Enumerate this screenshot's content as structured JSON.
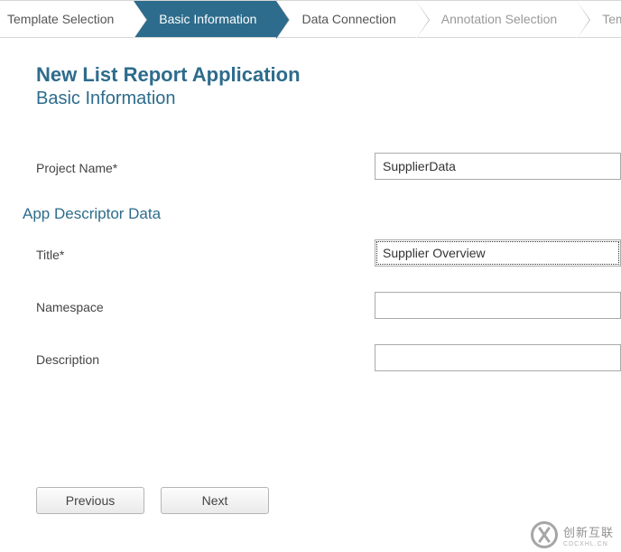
{
  "wizard": {
    "steps": [
      {
        "label": "Template Selection",
        "state": "done"
      },
      {
        "label": "Basic Information",
        "state": "active"
      },
      {
        "label": "Data Connection",
        "state": "upcoming"
      },
      {
        "label": "Annotation Selection",
        "state": "disabled"
      },
      {
        "label": "Templa",
        "state": "disabled"
      }
    ]
  },
  "header": {
    "title": "New List Report Application",
    "subtitle": "Basic Information"
  },
  "form": {
    "project_name_label": "Project Name*",
    "project_name_value": "SupplierData",
    "section_label": "App Descriptor Data",
    "title_label": "Title*",
    "title_value": "Supplier Overview",
    "namespace_label": "Namespace",
    "namespace_value": "",
    "description_label": "Description",
    "description_value": ""
  },
  "buttons": {
    "previous": "Previous",
    "next": "Next"
  },
  "watermark": {
    "text": "创新互联",
    "sub": "CDCXHL.CN"
  }
}
